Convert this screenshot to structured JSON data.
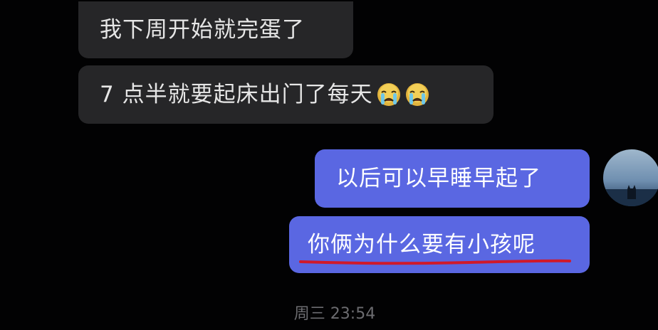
{
  "messages": [
    {
      "direction": "incoming",
      "text": "我下周开始就完蛋了"
    },
    {
      "direction": "incoming",
      "text": "7 点半就要起床出门了每天",
      "emojis": [
        "crying-face",
        "crying-face"
      ]
    },
    {
      "direction": "outgoing",
      "text": "以后可以早睡早起了"
    },
    {
      "direction": "outgoing",
      "text": "你俩为什么要有小孩呢",
      "underline_color": "#d0192a"
    }
  ],
  "timestamp": "周三 23:54",
  "avatar": {
    "icon": "cat-silhouette-sky-avatar"
  },
  "colors": {
    "background": "#020203",
    "incoming_bubble": "#262628",
    "outgoing_bubble": "#5a67e2",
    "timestamp_text": "#6c6c70"
  }
}
